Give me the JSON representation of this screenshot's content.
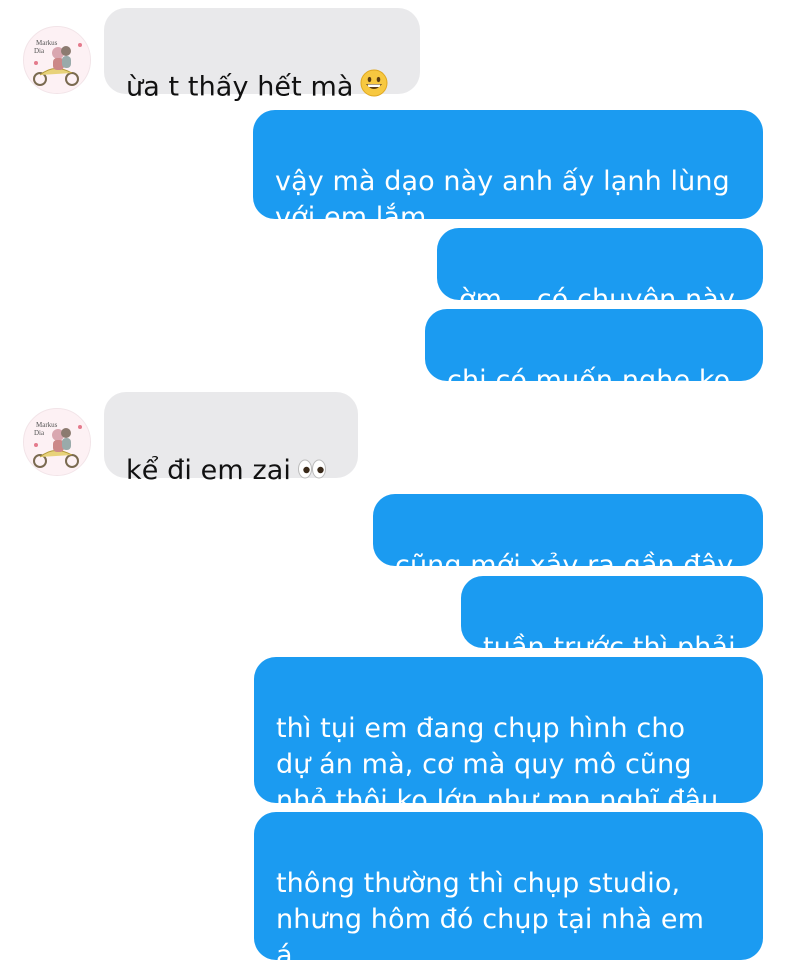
{
  "messages": [
    {
      "side": "in",
      "text": "ừa t thấy hết mà",
      "emoji": "grinning-face"
    },
    {
      "side": "out",
      "text": "vậy mà dạo này anh ấy lạnh lùng\nvới em lắm"
    },
    {
      "side": "out",
      "text": "ờm... có chuyện này"
    },
    {
      "side": "out",
      "text": "chị có muốn nghe ko"
    },
    {
      "side": "in",
      "text": "kể đi em zai",
      "emoji": "eyes"
    },
    {
      "side": "out",
      "text": "cũng mới xảy ra gần đây"
    },
    {
      "side": "out",
      "text": "tuần trước thì phải"
    },
    {
      "side": "out",
      "text": "thì tụi em đang chụp hình cho\ndự án mà, cơ mà quy mô cũng\nnhỏ thôi ko lớn như mn nghĩ đâu"
    },
    {
      "side": "out",
      "text": "thông thường thì chụp studio,\nnhưng hôm đó chụp tại nhà em\ná"
    }
  ],
  "colors": {
    "outgoing_bubble": "#1b9bf1",
    "incoming_bubble": "#e9e9eb",
    "background": "#ffffff"
  },
  "avatar": {
    "icon": "couple-on-scooter-avatar-icon"
  }
}
